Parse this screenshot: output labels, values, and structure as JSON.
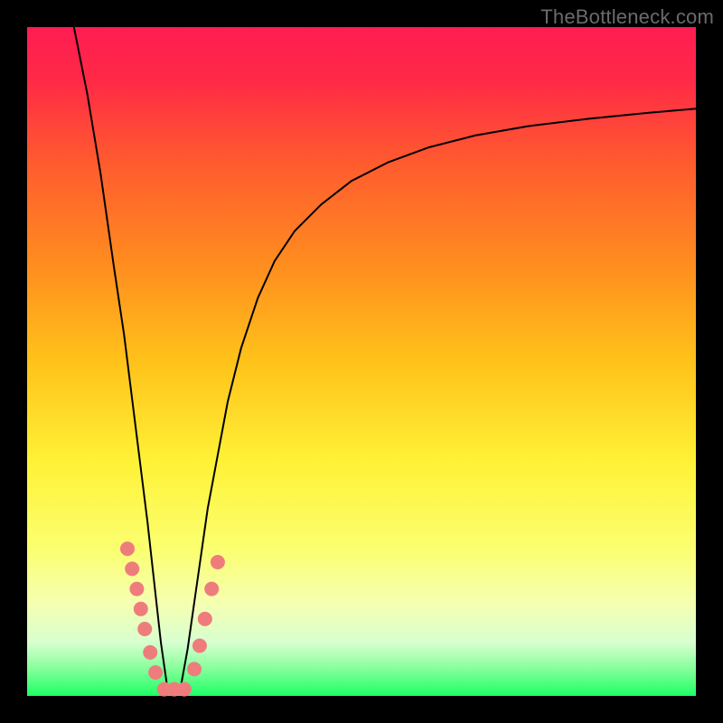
{
  "watermark": "TheBottleneck.com",
  "chart_data": {
    "type": "line",
    "title": "",
    "xlabel": "",
    "ylabel": "",
    "xlim": [
      0,
      100
    ],
    "ylim": [
      0,
      100
    ],
    "grid": false,
    "legend": false,
    "curve_color": "#000000",
    "curve_stroke": 2,
    "gradient": {
      "stops": [
        {
          "pos": 0.0,
          "color": "#ff1c52"
        },
        {
          "pos": 0.08,
          "color": "#ff2a46"
        },
        {
          "pos": 0.2,
          "color": "#ff5a2f"
        },
        {
          "pos": 0.35,
          "color": "#ff8b1f"
        },
        {
          "pos": 0.5,
          "color": "#ffc21a"
        },
        {
          "pos": 0.65,
          "color": "#fff236"
        },
        {
          "pos": 0.78,
          "color": "#fbff70"
        },
        {
          "pos": 0.86,
          "color": "#f5ffb0"
        },
        {
          "pos": 0.92,
          "color": "#d8ffcf"
        },
        {
          "pos": 0.96,
          "color": "#84ff9a"
        },
        {
          "pos": 1.0,
          "color": "#1dff66"
        }
      ]
    },
    "annotations": {
      "dots_color": "#ef7c7c",
      "dots_radius": 8,
      "dots": [
        {
          "x": 15.0,
          "y": 22.0
        },
        {
          "x": 15.7,
          "y": 19.0
        },
        {
          "x": 16.4,
          "y": 16.0
        },
        {
          "x": 17.0,
          "y": 13.0
        },
        {
          "x": 17.6,
          "y": 10.0
        },
        {
          "x": 18.4,
          "y": 6.5
        },
        {
          "x": 19.2,
          "y": 3.5
        },
        {
          "x": 20.5,
          "y": 1.0
        },
        {
          "x": 22.0,
          "y": 1.0
        },
        {
          "x": 23.5,
          "y": 1.0
        },
        {
          "x": 25.0,
          "y": 4.0
        },
        {
          "x": 25.8,
          "y": 7.5
        },
        {
          "x": 26.6,
          "y": 11.5
        },
        {
          "x": 27.6,
          "y": 16.0
        },
        {
          "x": 28.5,
          "y": 20.0
        }
      ]
    },
    "series": [
      {
        "name": "curve",
        "x": [
          7.0,
          9.0,
          11.0,
          13.0,
          14.5,
          16.0,
          17.0,
          18.0,
          19.0,
          20.0,
          21.0,
          22.0,
          23.0,
          24.0,
          25.0,
          26.0,
          27.0,
          28.5,
          30.0,
          32.0,
          34.5,
          37.0,
          40.0,
          44.0,
          48.5,
          54.0,
          60.0,
          67.0,
          75.0,
          84.0,
          93.0,
          100.0
        ],
        "y": [
          100.0,
          90.0,
          78.0,
          64.0,
          54.0,
          42.0,
          34.0,
          26.0,
          17.0,
          8.0,
          1.0,
          0.5,
          1.5,
          7.0,
          14.0,
          21.0,
          28.0,
          36.0,
          44.0,
          52.0,
          59.5,
          65.0,
          69.5,
          73.5,
          77.0,
          79.8,
          82.0,
          83.8,
          85.2,
          86.3,
          87.2,
          87.8
        ]
      }
    ]
  }
}
